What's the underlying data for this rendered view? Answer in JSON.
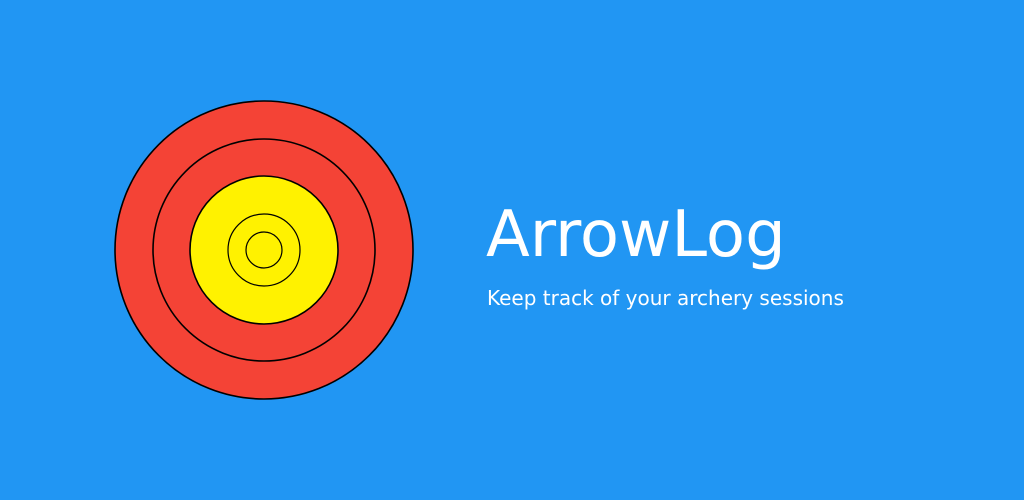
{
  "app": {
    "title": "ArrowLog",
    "tagline": "Keep track of your archery sessions"
  },
  "target_icon": {
    "icon": "archery-target-icon",
    "colors": {
      "background": "#2196F3",
      "outer_ring": "#F44336",
      "inner_gold": "#FFF200",
      "ring_line": "#000000"
    }
  }
}
